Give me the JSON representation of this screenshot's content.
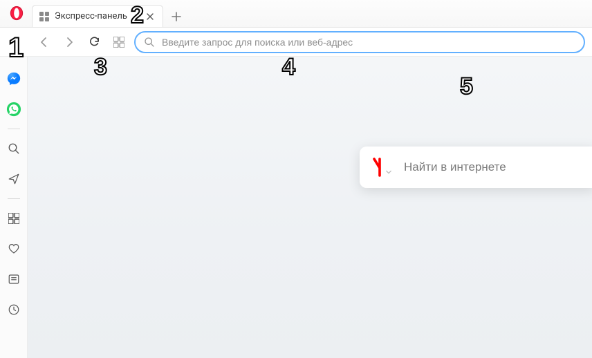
{
  "tab": {
    "title": "Экспресс-панель"
  },
  "addressbar": {
    "placeholder": "Введите запрос для поиска или веб-адрес",
    "value": ""
  },
  "search_widget": {
    "placeholder": "Найти в интернете",
    "provider": "Яндекс"
  },
  "annotations": {
    "n1": "1",
    "n2": "2",
    "n3": "3",
    "n4": "4",
    "n5": "5"
  },
  "sidebar": {
    "messenger": "messenger",
    "whatsapp": "whatsapp",
    "search": "search",
    "send": "send",
    "speed_dial": "speed-dial",
    "bookmarks": "bookmarks",
    "news": "news",
    "history": "history"
  }
}
